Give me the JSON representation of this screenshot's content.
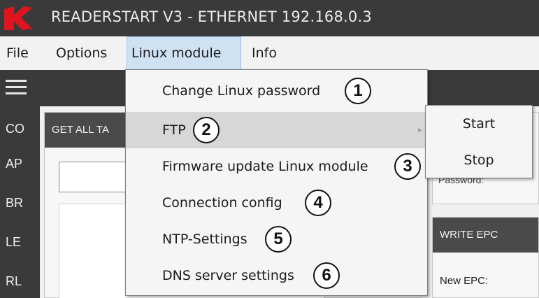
{
  "window": {
    "title": "READERSTART V3 - ETHERNET 192.168.0.3",
    "logo_icon": "app-logo",
    "logo_color": "#e0141e"
  },
  "menubar": {
    "items": [
      {
        "label": "File"
      },
      {
        "label": "Options"
      },
      {
        "label": "Linux module",
        "active": true
      },
      {
        "label": "Info"
      }
    ]
  },
  "sidebar": {
    "menu_icon": "hamburger-icon",
    "items": [
      {
        "label": "CO"
      },
      {
        "label": "AP"
      },
      {
        "label": "BR"
      },
      {
        "label": "LE"
      },
      {
        "label": "RL"
      }
    ]
  },
  "main": {
    "left_panel_header": "GET ALL TA",
    "password_label": "Password:",
    "write_epc_header": "WRITE EPC",
    "new_epc_label": "New EPC:"
  },
  "dropdown": {
    "items": [
      {
        "label": "Change Linux password",
        "badge": "1"
      },
      {
        "label": "FTP",
        "badge": "2",
        "has_submenu": true,
        "hover": true
      },
      {
        "label": "Firmware update Linux module",
        "badge": "3"
      },
      {
        "label": "Connection config",
        "badge": "4"
      },
      {
        "label": "NTP-Settings",
        "badge": "5"
      },
      {
        "label": "DNS server settings",
        "badge": "6"
      }
    ],
    "submenu_arrow": "▸"
  },
  "submenu": {
    "items": [
      {
        "label": "Start"
      },
      {
        "label": "Stop"
      }
    ]
  }
}
